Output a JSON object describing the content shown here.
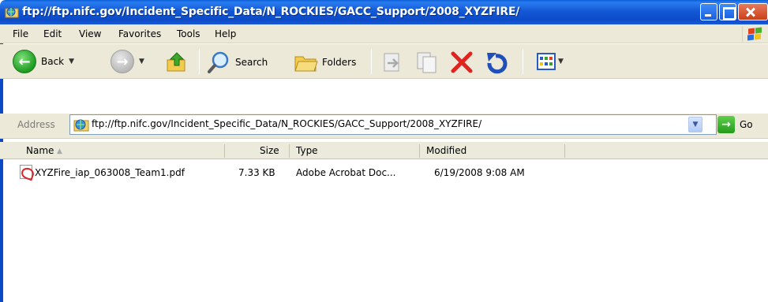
{
  "window": {
    "title": "ftp://ftp.nifc.gov/Incident_Specific_Data/N_ROCKIES/GACC_Support/2008_XYZFIRE/"
  },
  "menu": {
    "items": [
      "File",
      "Edit",
      "View",
      "Favorites",
      "Tools",
      "Help"
    ]
  },
  "toolbar": {
    "back_label": "Back",
    "search_label": "Search",
    "folders_label": "Folders"
  },
  "address": {
    "label": "Address",
    "value": "ftp://ftp.nifc.gov/Incident_Specific_Data/N_ROCKIES/GACC_Support/2008_XYZFIRE/",
    "go_label": "Go"
  },
  "list": {
    "columns": [
      "Name",
      "Size",
      "Type",
      "Modified"
    ],
    "rows": [
      {
        "name": "XYZFire_iap_063008_Team1.pdf",
        "size": "7.33 KB",
        "type": "Adobe Acrobat Doc...",
        "modified": "6/19/2008 9:08 AM"
      }
    ]
  },
  "colors": {
    "titlebar": "#1458d6",
    "chrome": "#ece9d8",
    "delete_red": "#e0231e",
    "go_green": "#249b1c"
  },
  "icons": [
    "folder-globe-icon",
    "windows-logo-icon",
    "back-arrow-icon",
    "forward-arrow-icon",
    "up-folder-icon",
    "search-icon",
    "folders-icon",
    "move-to-icon",
    "copy-to-icon",
    "delete-icon",
    "undo-icon",
    "views-icon",
    "pdf-file-icon",
    "sort-arrow-icon"
  ]
}
